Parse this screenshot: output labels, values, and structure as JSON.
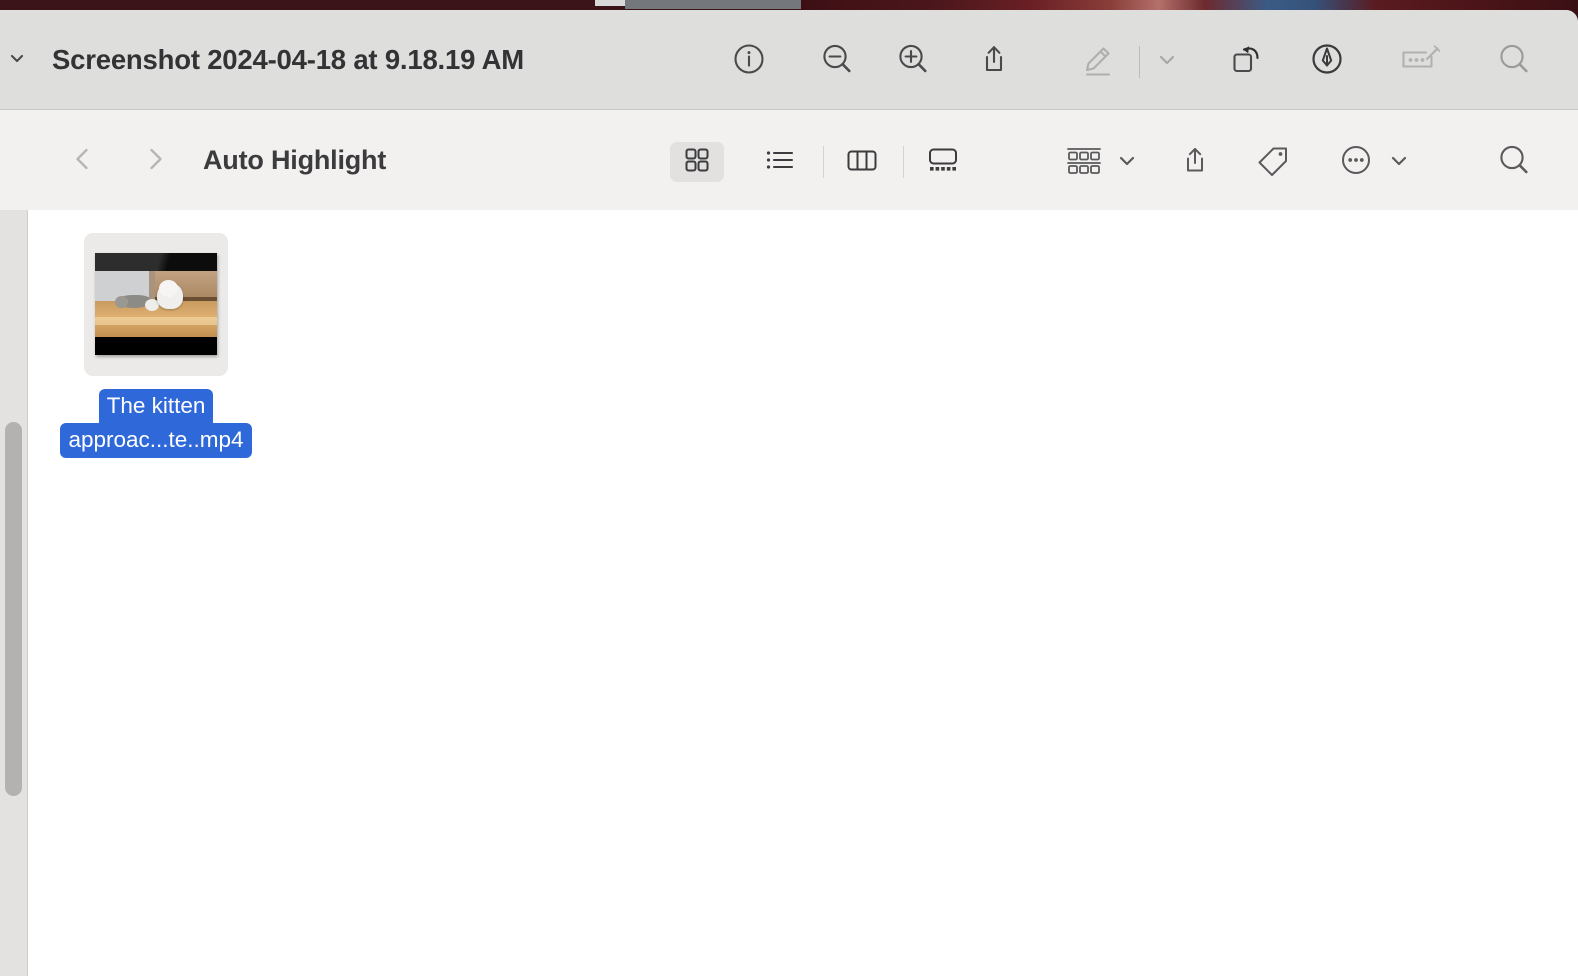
{
  "desktop": {
    "background_color": "#3a1418"
  },
  "titlebar": {
    "title": "Screenshot 2024-04-18 at 9.18.19 AM",
    "background_color": "#dededc",
    "chevron_icon": "chevron-down-icon",
    "buttons": [
      {
        "name": "info-button",
        "icon": "info-circle-icon",
        "label": "Info"
      },
      {
        "name": "zoom-out-button",
        "icon": "magnifier-minus-icon",
        "label": "Zoom Out"
      },
      {
        "name": "zoom-in-button",
        "icon": "magnifier-plus-icon",
        "label": "Zoom In"
      },
      {
        "name": "share-button",
        "icon": "share-icon",
        "label": "Share"
      },
      {
        "name": "markup-pen-button",
        "icon": "pencil-underline-icon",
        "label": "Markup",
        "disabled": true
      },
      {
        "name": "markup-options-button",
        "icon": "chevron-down-icon",
        "label": "Markup Options"
      },
      {
        "name": "rotate-button",
        "icon": "rotate-left-icon",
        "label": "Rotate"
      },
      {
        "name": "annotate-button",
        "icon": "pen-circle-icon",
        "label": "Annotate"
      },
      {
        "name": "sign-button",
        "icon": "signature-card-icon",
        "label": "Sign"
      },
      {
        "name": "search-button",
        "icon": "search-icon",
        "label": "Search"
      }
    ]
  },
  "finder_toolbar": {
    "background_color": "#f2f1f0",
    "back_label": "Back",
    "forward_label": "Forward",
    "folder_title": "Auto Highlight",
    "view_modes": [
      {
        "name": "icon-view",
        "icon": "grid-icon",
        "label": "Icon View",
        "selected": true
      },
      {
        "name": "list-view",
        "icon": "list-icon",
        "label": "List View",
        "selected": false
      },
      {
        "name": "column-view",
        "icon": "columns-icon",
        "label": "Column View",
        "selected": false
      },
      {
        "name": "gallery-view",
        "icon": "gallery-icon",
        "label": "Gallery View",
        "selected": false
      }
    ],
    "actions": [
      {
        "name": "group-by-button",
        "icon": "group-grid-icon",
        "label": "Group"
      },
      {
        "name": "group-by-chevron",
        "icon": "chevron-down-icon",
        "label": "Group Options"
      },
      {
        "name": "share-button",
        "icon": "share-icon",
        "label": "Share"
      },
      {
        "name": "tag-button",
        "icon": "tag-icon",
        "label": "Tags"
      },
      {
        "name": "more-button",
        "icon": "ellipsis-circle-icon",
        "label": "More"
      },
      {
        "name": "more-chevron",
        "icon": "chevron-down-icon",
        "label": "More Options"
      },
      {
        "name": "search-button",
        "icon": "search-icon",
        "label": "Search"
      }
    ]
  },
  "scrollbar": {
    "orientation": "vertical",
    "position": "left",
    "track_color": "#e3e2e0",
    "thumb_color": "#b3b2b0"
  },
  "content": {
    "background_color": "#ffffff",
    "selection_color": "#2f68d8",
    "files": [
      {
        "name": "video-file",
        "label_line_1": "The kitten",
        "label_line_2": "approac...te..mp4",
        "full_name": "The kitten approac...te..mp4",
        "kind": "mp4-video",
        "selected": true,
        "thumbnail": "kitten-video-thumbnail"
      }
    ]
  }
}
